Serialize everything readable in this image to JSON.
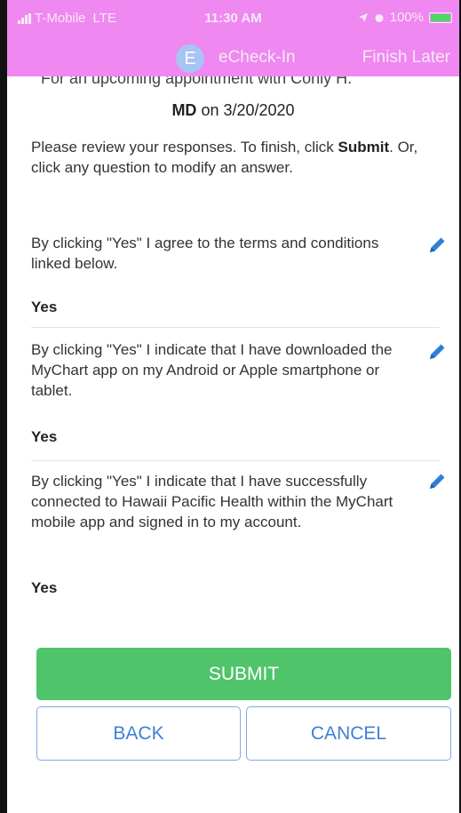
{
  "status_bar": {
    "carrier": "T-Mobile",
    "network": "LTE",
    "time": "11:30 AM",
    "battery": "100%"
  },
  "nav": {
    "avatar_letter": "E",
    "title": "eCheck-In",
    "finish_later": "Finish Later"
  },
  "appointment": {
    "line1": "For an upcoming appointment with Conly H.",
    "line2_bold": "MD",
    "line2_rest": " on 3/20/2020"
  },
  "intro": {
    "part1": "Please review your responses. To finish, click ",
    "submit_word": "Submit",
    "part2": ". Or, click any question to modify an answer."
  },
  "questions": [
    {
      "text": "By clicking \"Yes\" I agree to the terms and conditions linked below.",
      "answer": "Yes"
    },
    {
      "text": "By clicking \"Yes\" I indicate that I have downloaded the MyChart app on my Android or Apple smartphone or tablet.",
      "answer": "Yes"
    },
    {
      "text": "By clicking \"Yes\" I indicate that I have successfully connected to Hawaii Pacific Health within the MyChart mobile app and signed in to my account.",
      "answer": "Yes"
    }
  ],
  "buttons": {
    "submit": "SUBMIT",
    "back": "BACK",
    "cancel": "CANCEL"
  },
  "colors": {
    "header": "#ef88f0",
    "submit": "#4fc46a",
    "secondary_border": "#7fa9e6",
    "secondary_text": "#3f7fd6",
    "edit_icon": "#2f7fd8"
  }
}
